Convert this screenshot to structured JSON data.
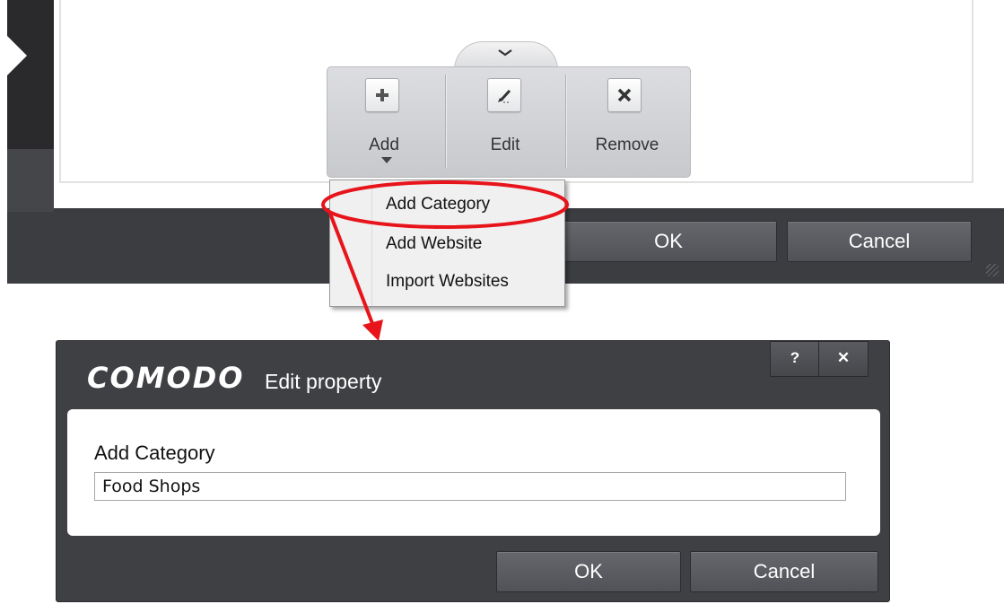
{
  "toolbar": {
    "add_label": "Add",
    "edit_label": "Edit",
    "remove_label": "Remove"
  },
  "background_window": {
    "ok_label": "OK",
    "cancel_label": "Cancel"
  },
  "dropdown": {
    "items": [
      {
        "label": "Add Category"
      },
      {
        "label": "Add Website"
      },
      {
        "label": "Import Websites"
      }
    ]
  },
  "dialog": {
    "logo": "COMODO",
    "title": "Edit property",
    "help_label": "?",
    "close_label": "✕",
    "field_label": "Add Category",
    "field_value": "Food Shops",
    "ok_label": "OK",
    "cancel_label": "Cancel"
  },
  "icons": [
    "chevron-down-icon",
    "plus-icon",
    "pencil-icon",
    "x-icon",
    "dropdown-caret-icon",
    "resize-grip-icon"
  ],
  "colors": {
    "dialog_bg": "#3f4044",
    "button_bg": "#5b5d62",
    "toolbar_bg": "#d3d4d7",
    "annotation_red": "#e8141b"
  }
}
